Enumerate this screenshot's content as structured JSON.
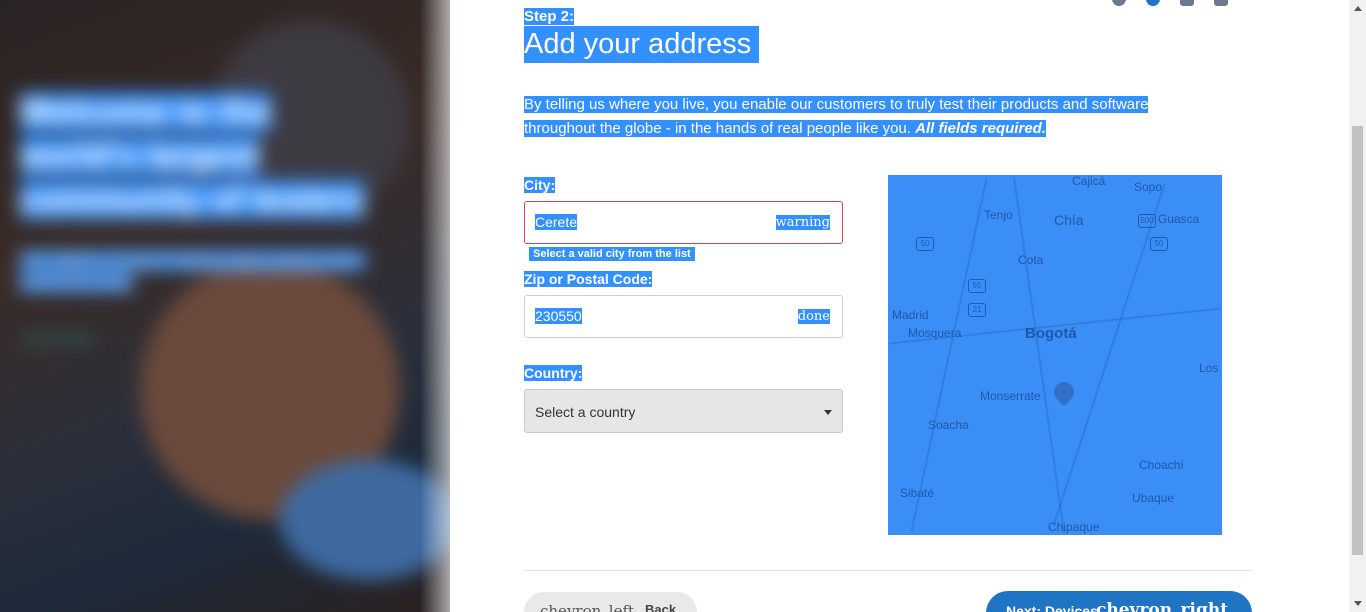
{
  "hero": {
    "headline": "Welcome to the world's largest community of testers",
    "subtext": "Join millions of testers helping make products better around the world",
    "link": "Learn more"
  },
  "form": {
    "step": "Step 2:",
    "title": "Add your address",
    "description": "By telling us where you live, you enable our customers to truly test their products and software throughout the globe - in the hands of real people like you.",
    "required_note": "All fields required.",
    "city": {
      "label": "City:",
      "value": "Cerete",
      "status_icon": "warning",
      "help": "Select a valid city from the list"
    },
    "zip": {
      "label": "Zip or Postal Code:",
      "value": "230550",
      "status_icon": "done"
    },
    "country": {
      "label": "Country:",
      "selected": "Select a country"
    }
  },
  "map": {
    "labels": [
      "Cajicá",
      "Sopo",
      "Tenjo",
      "Chía",
      "Guasca",
      "Cota",
      "Madrid",
      "Mosquera",
      "Bogotá",
      "Los",
      "Monserrate",
      "Soacha",
      "Choachí",
      "Sibaté",
      "Ubaque",
      "Chipaque"
    ],
    "roads": [
      "50",
      "500",
      "50",
      "55",
      "21"
    ]
  },
  "nav": {
    "back_icon": "chevron_left",
    "back_label": "Back",
    "next_label": "Next: Devices",
    "next_icon": "chevron_right"
  },
  "colors": {
    "selection": "#3390ff",
    "error_border": "#d9414c",
    "next_button": "#1f74c4"
  }
}
